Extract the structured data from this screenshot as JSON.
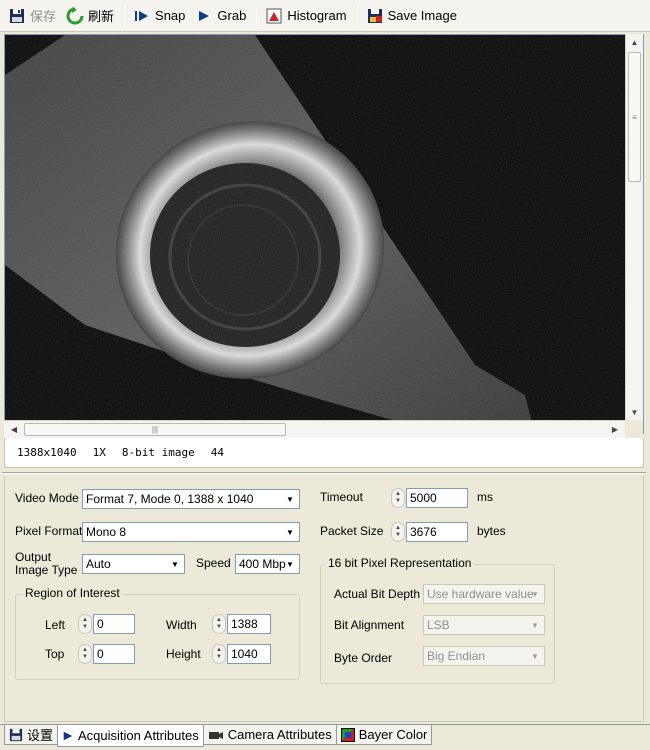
{
  "toolbar": {
    "save": "保存",
    "refresh": "刷新",
    "snap": "Snap",
    "grab": "Grab",
    "histogram": "Histogram",
    "save_image": "Save Image"
  },
  "status": {
    "resolution": "1388x1040",
    "zoom": "1X",
    "bit_depth": "8-bit image",
    "value": "44"
  },
  "settings": {
    "video_mode_label": "Video Mode",
    "video_mode_value": "Format 7, Mode 0, 1388 x 1040",
    "pixel_format_label": "Pixel Format",
    "pixel_format_value": "Mono 8",
    "output_type_label_1": "Output",
    "output_type_label_2": "Image Type",
    "output_type_value": "Auto",
    "speed_label": "Speed",
    "speed_value": "400 Mbp",
    "timeout_label": "Timeout",
    "timeout_value": "5000",
    "timeout_unit": "ms",
    "packet_size_label": "Packet Size",
    "packet_size_value": "3676",
    "packet_size_unit": "bytes"
  },
  "roi": {
    "title": "Region of Interest",
    "left_label": "Left",
    "left_value": "0",
    "top_label": "Top",
    "top_value": "0",
    "width_label": "Width",
    "width_value": "1388",
    "height_label": "Height",
    "height_value": "1040"
  },
  "pixel_rep": {
    "title": "16 bit Pixel Representation",
    "actual_bit_depth_label": "Actual Bit Depth",
    "actual_bit_depth_value": "Use hardware value",
    "bit_alignment_label": "Bit Alignment",
    "bit_alignment_value": "LSB",
    "byte_order_label": "Byte Order",
    "byte_order_value": "Big Endian"
  },
  "tabs": [
    {
      "label": "设置",
      "icon": "save-icon"
    },
    {
      "label": "Acquisition Attributes",
      "icon": "play-icon"
    },
    {
      "label": "Camera Attributes",
      "icon": "camera-icon"
    },
    {
      "label": "Bayer Color",
      "icon": "color-icon"
    }
  ],
  "colors": {
    "accent_blue": "#0a3c8c",
    "refresh_green": "#2e9b2e",
    "histogram_red": "#cc2222"
  }
}
